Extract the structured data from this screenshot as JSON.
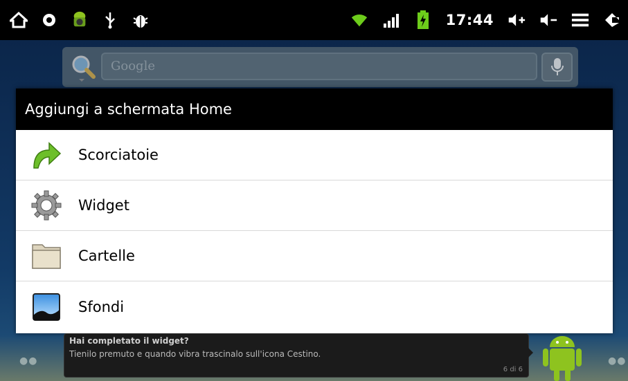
{
  "status_bar": {
    "time": "17:44",
    "left_icons": [
      "home-icon",
      "record-icon",
      "android-icon",
      "usb-icon",
      "debug-icon"
    ],
    "right_icons": [
      "wifi-icon",
      "signal-icon",
      "battery-charging-icon",
      "volume-up-icon",
      "volume-down-icon",
      "menu-icon",
      "back-icon"
    ]
  },
  "search": {
    "placeholder": "Google"
  },
  "dialog": {
    "title": "Aggiungi a schermata Home",
    "items": [
      {
        "label": "Scorciatoie",
        "icon": "shortcut-arrow-icon"
      },
      {
        "label": "Widget",
        "icon": "widget-gear-icon"
      },
      {
        "label": "Cartelle",
        "icon": "folder-icon"
      },
      {
        "label": "Sfondi",
        "icon": "wallpaper-icon"
      }
    ]
  },
  "tooltip": {
    "title": "Hai completato il widget?",
    "body": "Tienilo premuto e quando vibra trascinalo sull'icona Cestino.",
    "count": "6 di 6"
  },
  "colors": {
    "status_bg": "#000000",
    "dialog_title_bg": "#000000",
    "accent_green": "#8ec31f"
  }
}
